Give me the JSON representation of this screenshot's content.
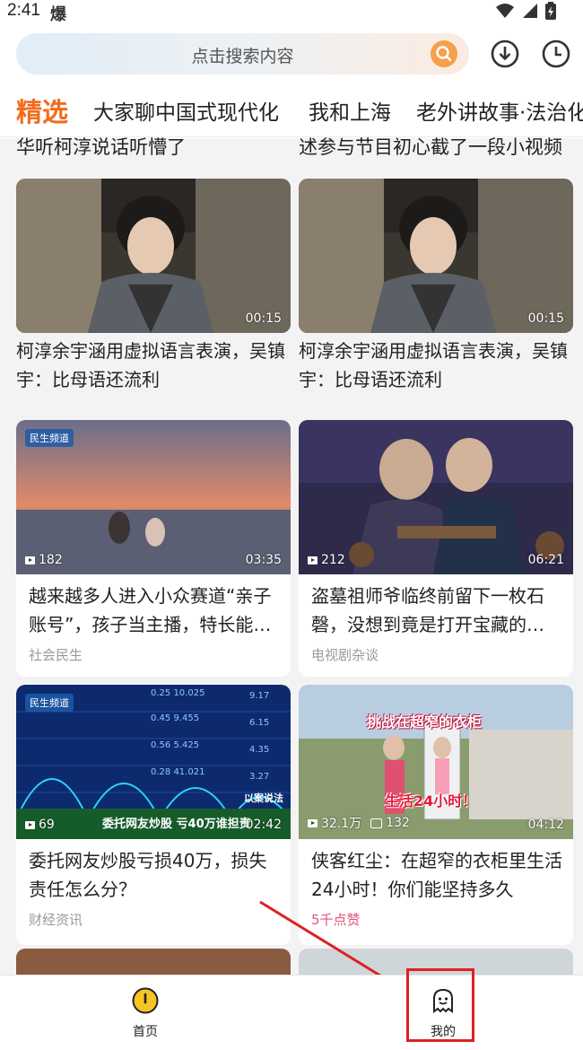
{
  "status_bar": {
    "time": "2:41",
    "notify_icon": "burst-icon"
  },
  "search": {
    "placeholder": "点击搜索内容"
  },
  "tabs": [
    "精选",
    "大家聊中国式现代化",
    "我和上海",
    "老外讲故事·法治化"
  ],
  "clipped_titles": [
    "华听柯淳说话听懵了",
    "述参与节目初心截了一段小视频"
  ],
  "cards": [
    {
      "title": "柯淳余宇涵用虚拟语言表演，吴镇宇：比母语还流利",
      "duration": "00:15"
    },
    {
      "title": "柯淳余宇涵用虚拟语言表演，吴镇宇：比母语还流利",
      "duration": "00:15"
    },
    {
      "title": "越来越多人进入小众赛道“亲子账号”，孩子当主播，特长能…",
      "plays": "182",
      "duration": "03:35",
      "meta": "社会民生",
      "logo": "民生频道"
    },
    {
      "title": "盗墓祖师爷临终前留下一枚石磬，没想到竟是打开宝藏的…",
      "plays": "212",
      "duration": "06:21",
      "meta": "电视剧杂谈"
    },
    {
      "title": "委托网友炒股亏损40万，损失责任怎么分？",
      "plays": "69",
      "duration": "02:42",
      "meta": "财经资讯",
      "logo": "民生频道",
      "overlay_caption": "委托网友炒股  亏40万谁担责",
      "overlay_tag": "以案说法"
    },
    {
      "title": "侠客红尘：在超窄的衣柜里生活24小时！你们能坚持多久",
      "plays": "32.1万",
      "comments": "132",
      "duration": "04:12",
      "meta": "5千点赞",
      "overlay_top": "挑战在超窄的衣柜",
      "overlay_bottom": "生活24小时！"
    }
  ],
  "bottom_nav": [
    {
      "label": "首页",
      "icon": "home-icon"
    },
    {
      "label": "我的",
      "icon": "profile-icon"
    }
  ],
  "colors": {
    "accent": "#f26b1d",
    "search_button": "#f6a04b",
    "annotation_red": "#e02020",
    "home_icon": "#f7c325"
  }
}
